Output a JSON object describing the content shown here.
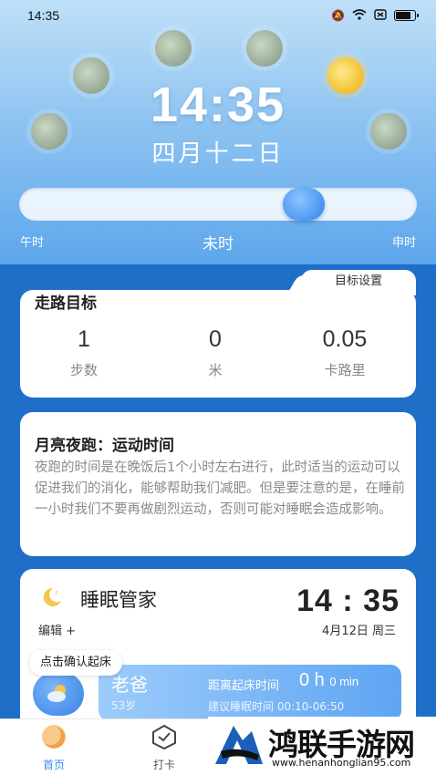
{
  "status_bar": {
    "time": "14:35"
  },
  "hero": {
    "time": "14:35",
    "date": "四月十二日",
    "slider": {
      "left_label": "午时",
      "current_label": "未时",
      "right_label": "申时",
      "position": 0.74
    }
  },
  "walk": {
    "settings_tab": "目标设置",
    "title": "走路目标",
    "stats": [
      {
        "value": "1",
        "unit": "步数"
      },
      {
        "value": "0",
        "unit": "米"
      },
      {
        "value": "0.05",
        "unit": "卡路里"
      }
    ]
  },
  "moon_run": {
    "title": "月亮夜跑：运动时间",
    "body": "夜跑的时间是在晚饭后1个小时左右进行，此时适当的运动可以促进我们的消化，能够帮助我们减肥。但是要注意的是，在睡前一小时我们不要再做剧烈运动，否则可能对睡眠会造成影响。"
  },
  "sleep": {
    "title": "睡眠管家",
    "time": "14 : 35",
    "date": "4月12日 周三",
    "edit_label": "编辑 +",
    "wake_bubble": "点击确认起床",
    "person": {
      "name": "老爸",
      "age": "53岁",
      "wake_label": "距离起床时间",
      "wake_hours": "0 h",
      "wake_minutes": "0 min",
      "suggest": "建议睡眠时间 00:10-06:50"
    }
  },
  "nav": {
    "home": "首页",
    "checkin": "打卡"
  },
  "watermark": {
    "title": "鸿联手游网",
    "url": "www.henanhonglian95.com"
  },
  "colors": {
    "accent": "#3a8af0",
    "background": "#1f6fc9",
    "sun_gold": "#f0b820"
  }
}
